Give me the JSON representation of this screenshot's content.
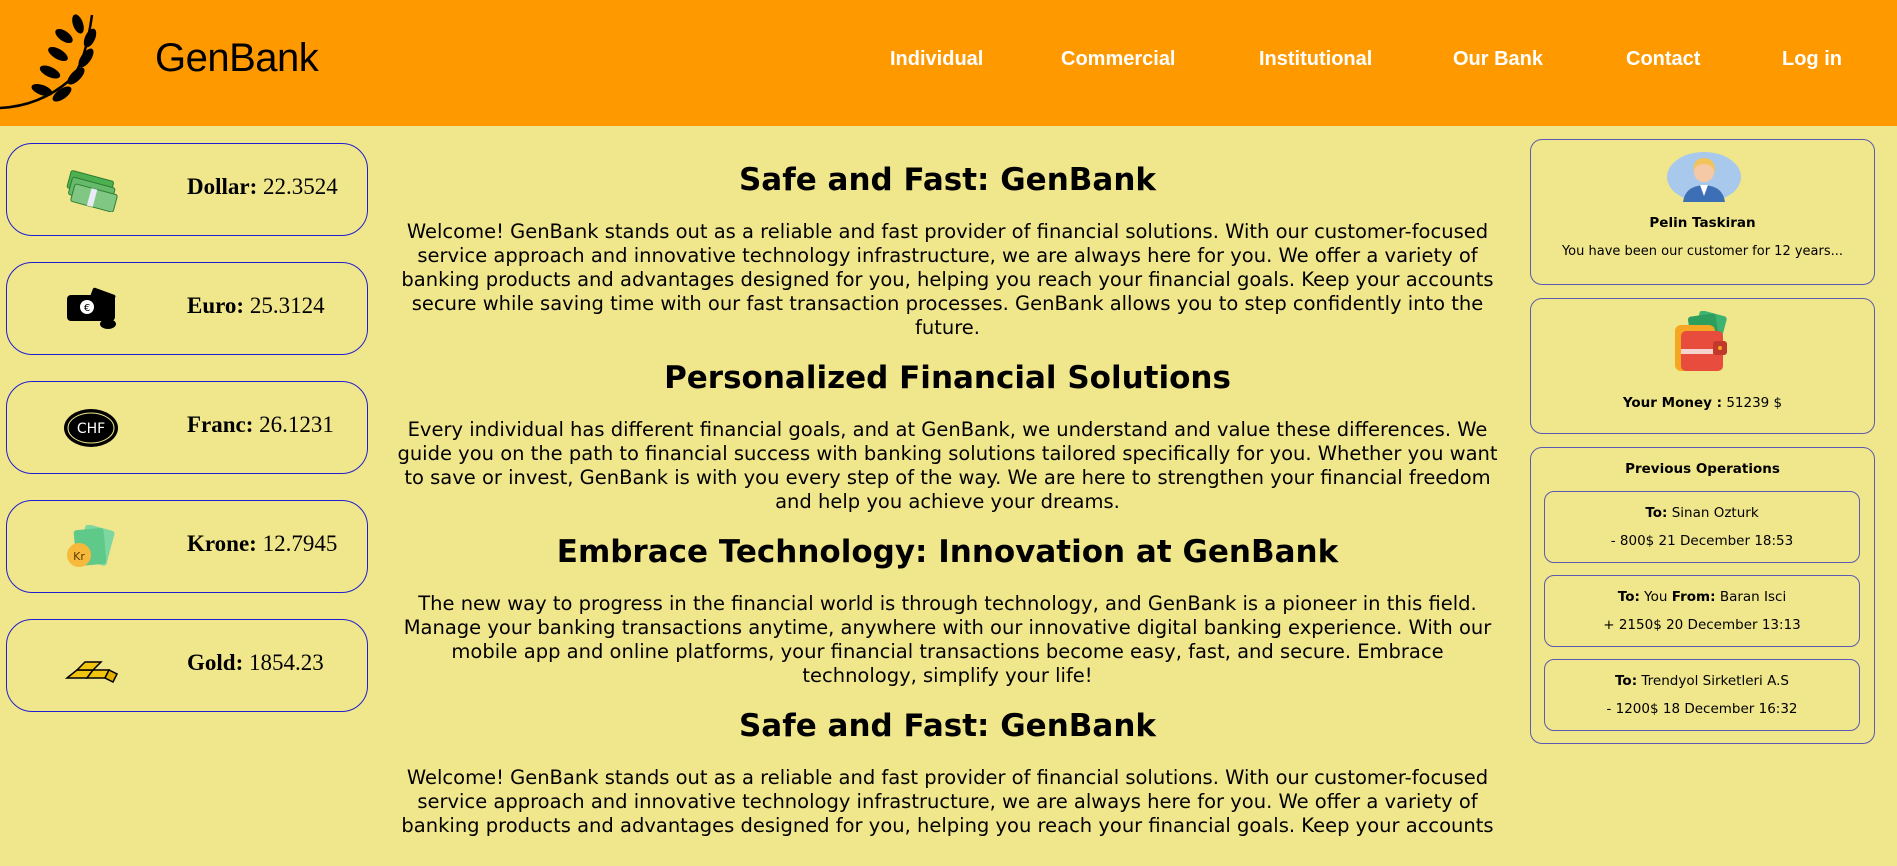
{
  "header": {
    "brand": "GenBank",
    "nav": [
      "Individual",
      "Commercial",
      "Institutional",
      "Our Bank",
      "Contact",
      "Log in"
    ]
  },
  "currencies": [
    {
      "name": "Dollar:",
      "value": "22.3524",
      "icon": "dollar-bills-icon"
    },
    {
      "name": "Euro:",
      "value": "25.3124",
      "icon": "euro-wallet-icon"
    },
    {
      "name": "Franc:",
      "value": "26.1231",
      "icon": "chf-coin-icon"
    },
    {
      "name": "Krone:",
      "value": "12.7945",
      "icon": "krone-money-icon"
    },
    {
      "name": "Gold:",
      "value": "1854.23",
      "icon": "gold-bars-icon"
    }
  ],
  "content": {
    "sections": [
      {
        "title": "Safe and Fast: GenBank",
        "lines": [
          "Welcome! GenBank stands out as a reliable and fast provider of financial solutions. With our customer-focused",
          "service approach and innovative technology infrastructure, we are always here for you. We offer a variety of",
          "banking products and advantages designed for you, helping you reach your financial goals. Keep your accounts",
          "secure while saving time with our fast transaction processes. GenBank allows you to step confidently into the",
          "future."
        ]
      },
      {
        "title": "Personalized Financial Solutions",
        "lines": [
          "Every individual has different financial goals, and at GenBank, we understand and value these differences. We",
          "guide you on the path to financial success with banking solutions tailored specifically for you. Whether you want",
          "to save or invest, GenBank is with you every step of the way. We are here to strengthen your financial freedom",
          "and help you achieve your dreams."
        ]
      },
      {
        "title": "Embrace Technology: Innovation at GenBank",
        "lines": [
          "The new way to progress in the financial world is through technology, and GenBank is a pioneer in this field.",
          "Manage your banking transactions anytime, anywhere with our innovative digital banking experience. With our",
          "mobile app and online platforms, your financial transactions become easy, fast, and secure. Embrace",
          "technology, simplify your life!"
        ]
      },
      {
        "title": "Safe and Fast: GenBank",
        "lines": [
          "Welcome! GenBank stands out as a reliable and fast provider of financial solutions. With our customer-focused",
          "service approach and innovative technology infrastructure, we are always here for you. We offer a variety of",
          "banking products and advantages designed for you, helping you reach your financial goals. Keep your accounts"
        ]
      }
    ]
  },
  "profile": {
    "name": "Pelin Taskiran",
    "note": "You have been our customer for 12 years..."
  },
  "wallet": {
    "label": "Your Money :",
    "amount": "51239 $"
  },
  "operations": {
    "title": "Previous Operations",
    "to_label": "To:",
    "from_label": "From:",
    "items": [
      {
        "to": "Sinan Ozturk",
        "from": "",
        "detail": "- 800$ 21 December 18:53"
      },
      {
        "to": "You",
        "from": "Baran Isci",
        "detail": "+ 2150$ 20 December 13:13"
      },
      {
        "to": "Trendyol Sirketleri A.S",
        "from": "",
        "detail": "- 1200$ 18 December 16:32"
      }
    ]
  },
  "colors": {
    "header_bg": "#ff9900",
    "page_bg": "#f0e68c",
    "border": "#1f1fd0"
  }
}
